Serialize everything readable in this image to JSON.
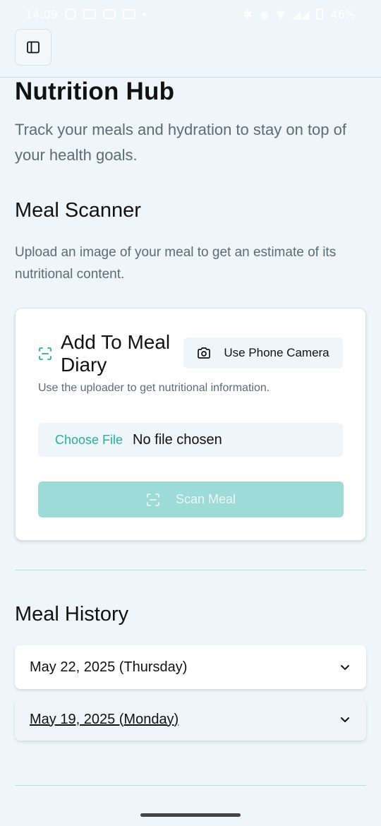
{
  "status_bar": {
    "time": "14:09",
    "battery": "46%"
  },
  "page": {
    "title": "Nutrition Hub",
    "subtitle": "Track your meals and hydration to stay on top of your health goals."
  },
  "meal_scanner": {
    "title": "Meal Scanner",
    "description": "Upload an image of your meal to get an estimate of its nutritional content.",
    "card": {
      "title": "Add To Meal Diary",
      "camera_button": "Use Phone Camera",
      "description": "Use the uploader to get nutritional information.",
      "file_choose": "Choose File",
      "file_status": "No file chosen",
      "scan_button": "Scan Meal"
    }
  },
  "meal_history": {
    "title": "Meal History",
    "items": [
      {
        "label": "May 22, 2025 (Thursday)"
      },
      {
        "label": "May 19, 2025 (Monday)"
      }
    ]
  },
  "colors": {
    "accent": "#2bab9e",
    "scan_button_bg": "#9ddbd7",
    "page_bg": "#eef6f9"
  },
  "icons": [
    "sidebar-toggle-icon",
    "scan-icon",
    "camera-icon",
    "chevron-down-icon"
  ]
}
